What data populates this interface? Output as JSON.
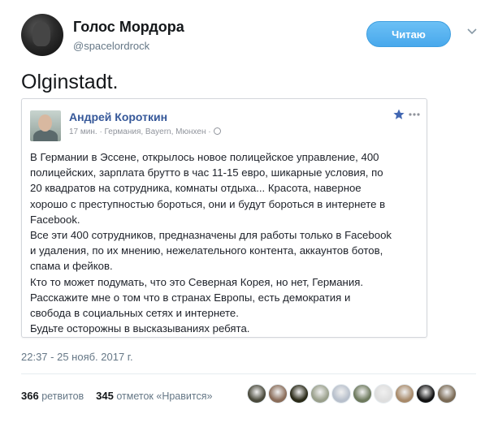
{
  "profile": {
    "display_name": "Голос Мордора",
    "handle": "@spacelordrock",
    "follow_label": "Читаю"
  },
  "tweet": {
    "text": "Olginstadt.",
    "timestamp": "22:37 - 25 нояб. 2017 г.",
    "retweet_count": "366",
    "retweet_label": "ретвитов",
    "like_count": "345",
    "like_label": "отметок «Нравится»"
  },
  "fb_post": {
    "author": "Андрей Короткин",
    "meta": "17 мин. · Германия, Bayern, Мюнхен ·",
    "lines": [
      "В Германии в Эссене, открылось новое полицейское управление, 400",
      "полицейских, зарплата брутто в час 11-15 евро, шикарные условия, по",
      "20 квадратов на сотрудника, комнаты отдыха... Красота, наверное",
      "хорошо с преступностью бороться, они и будут бороться в интернете в",
      "Facebook.",
      "Все эти 400 сотрудников, предназначены для работы только в Facebook",
      "и удаления, по их мнению, нежелательного контента, аккаунтов ботов,",
      "спама и фейков.",
      "Кто то может подумать, что это Северная Корея, но нет, Германия.",
      "Расскажите мне о том что в странах Европы, есть демократия и",
      "свобода в социальных сетях и интернете.",
      "Будьте осторожны в высказываниях ребята."
    ]
  },
  "likers": [
    {
      "icon": "liker-avatar-1",
      "color": "#4a4a3c"
    },
    {
      "icon": "liker-avatar-2",
      "color": "#8a6d5a"
    },
    {
      "icon": "liker-avatar-3",
      "color": "#2a2a18"
    },
    {
      "icon": "liker-avatar-4",
      "color": "#9aa08c"
    },
    {
      "icon": "liker-avatar-5",
      "color": "#b8c0cc"
    },
    {
      "icon": "liker-avatar-6",
      "color": "#6e7a5e"
    },
    {
      "icon": "liker-avatar-7",
      "color": "#dedede"
    },
    {
      "icon": "liker-avatar-8",
      "color": "#a88a6a"
    },
    {
      "icon": "liker-avatar-9",
      "color": "#111111"
    },
    {
      "icon": "liker-avatar-10",
      "color": "#7a6a55"
    }
  ],
  "colors": {
    "follow_button": "#55b0ee",
    "fb_author": "#365899",
    "muted_text": "#657786"
  }
}
